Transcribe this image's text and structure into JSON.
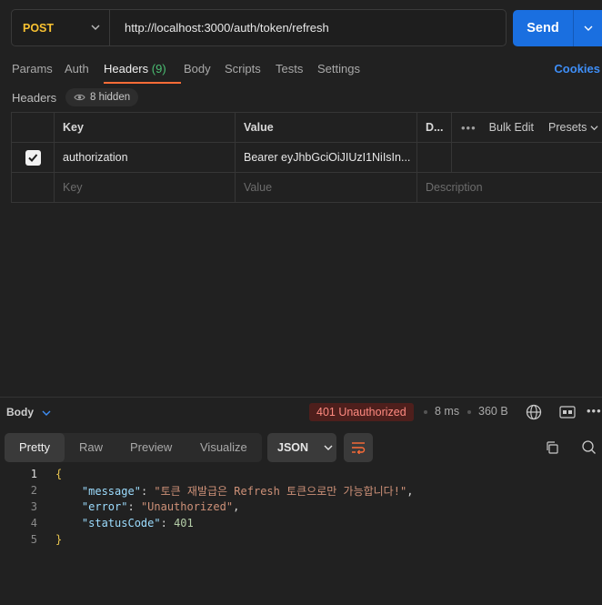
{
  "request": {
    "method": "POST",
    "url": "http://localhost:3000/auth/token/refresh",
    "send_label": "Send"
  },
  "request_tabs": {
    "params": "Params",
    "auth": "Auth",
    "headers": "Headers",
    "headers_count": "(9)",
    "body": "Body",
    "scripts": "Scripts",
    "tests": "Tests",
    "settings": "Settings",
    "cookies": "Cookies"
  },
  "headers_section": {
    "title": "Headers",
    "hidden_label": "8 hidden",
    "columns": {
      "key": "Key",
      "value": "Value",
      "description": "D...",
      "bulk_edit": "Bulk Edit",
      "presets": "Presets"
    },
    "rows": [
      {
        "checked": true,
        "key": "authorization",
        "value": "Bearer eyJhbGciOiJIUzI1NiIsIn..."
      }
    ],
    "placeholders": {
      "key": "Key",
      "value": "Value",
      "description": "Description"
    }
  },
  "response": {
    "title": "Body",
    "status": "401 Unauthorized",
    "time": "8 ms",
    "size": "360 B",
    "view_tabs": [
      "Pretty",
      "Raw",
      "Preview",
      "Visualize"
    ],
    "active_view": "Pretty",
    "format": "JSON",
    "lines": {
      "l1": "1",
      "l2": "2",
      "l3": "3",
      "l4": "4",
      "l5": "5",
      "open": "{",
      "message_key": "\"message\"",
      "message_val": "\"토큰 재발급은 Refresh 토큰으로만 가능합니다!\"",
      "error_key": "\"error\"",
      "error_val": "\"Unauthorized\"",
      "status_key": "\"statusCode\"",
      "status_val": "401",
      "close": "}"
    }
  },
  "colors": {
    "accent": "#ff6c37",
    "send": "#1a6fe0",
    "method": "#f8c131",
    "status_error": "#ff8a80",
    "count": "#4bbf73"
  }
}
